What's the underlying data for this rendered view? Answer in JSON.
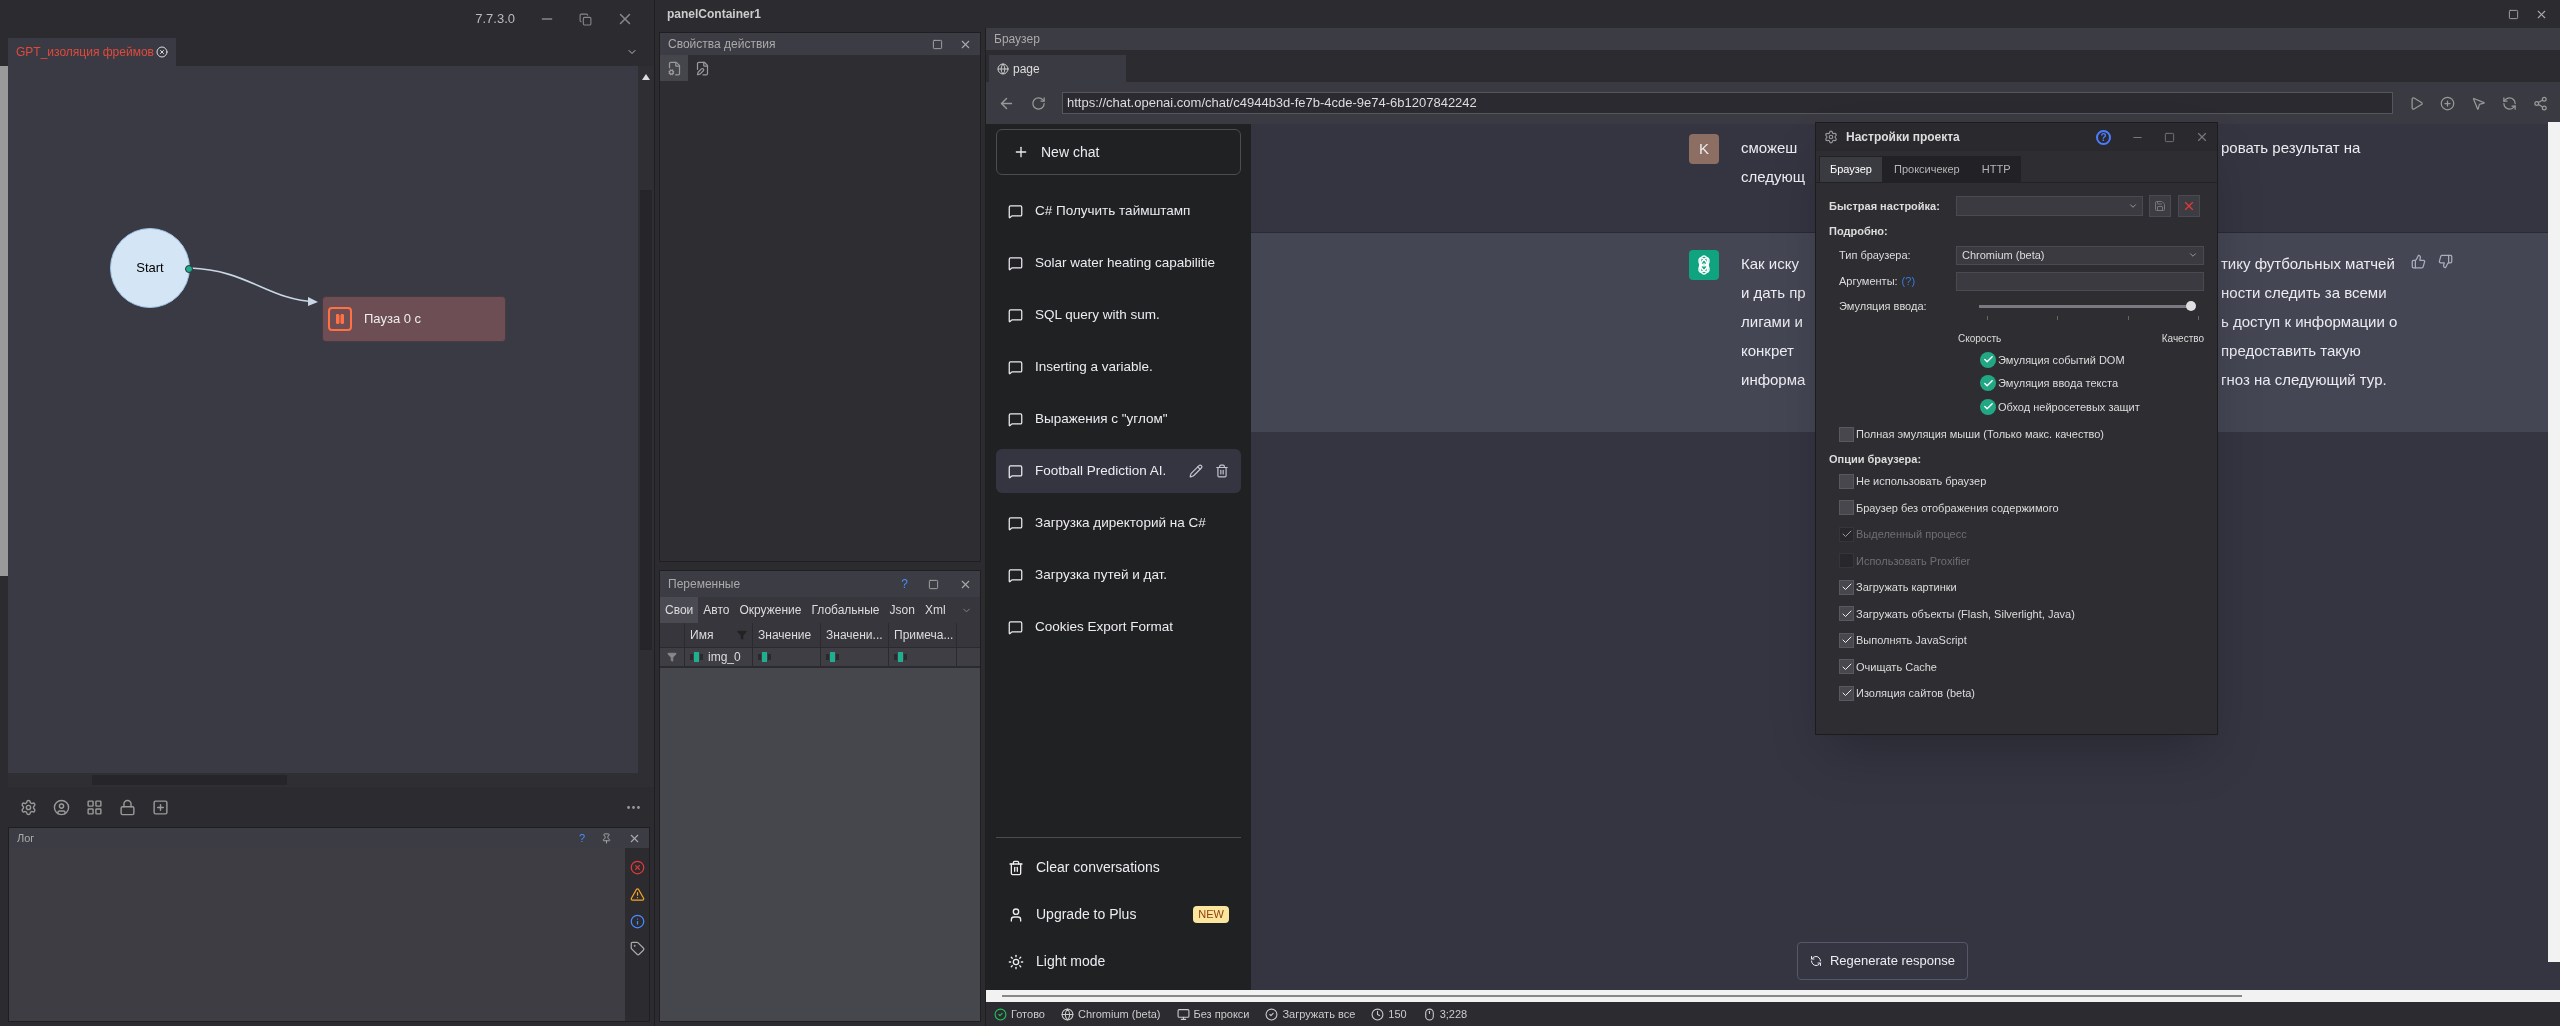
{
  "app": {
    "version": "7.7.3.0"
  },
  "editor": {
    "tab": {
      "label": "GPT_изоляция фреймов"
    },
    "nodes": [
      {
        "kind": "start",
        "label": "Start"
      },
      {
        "kind": "pause",
        "label": "Пауза 0 с"
      }
    ]
  },
  "log_panel": {
    "title": "Лог",
    "help": "?"
  },
  "panel_container": {
    "title": "panelContainer1"
  },
  "action_properties": {
    "title": "Свойства действия",
    "tools": [
      {
        "kind": "settings",
        "selected": true
      },
      {
        "kind": "edit",
        "selected": false
      }
    ]
  },
  "variables": {
    "title": "Переменные",
    "help": "?",
    "tabs": [
      {
        "label": "Свои",
        "selected": true
      },
      {
        "label": "Авто",
        "selected": false
      },
      {
        "label": "Окружение",
        "selected": false
      },
      {
        "label": "Глобальные",
        "selected": false
      },
      {
        "label": "Json",
        "selected": false
      },
      {
        "label": "Xml",
        "selected": false
      }
    ],
    "columns": [
      "Имя",
      "Значение",
      "Значени...",
      "Примеча..."
    ],
    "rows": [
      {
        "name": "img_0"
      }
    ]
  },
  "browser": {
    "title": "Браузер",
    "tab": "page",
    "url": "https://chat.openai.com/chat/c4944b3d-fe7b-4cde-9e74-6b1207842242",
    "sidebar": {
      "new_chat": "New chat",
      "chats": [
        {
          "title": "C# Получить таймштамп",
          "selected": false
        },
        {
          "title": "Solar water heating capabilitie",
          "selected": false
        },
        {
          "title": "SQL query with sum.",
          "selected": false
        },
        {
          "title": "Inserting a variable.",
          "selected": false
        },
        {
          "title": "Выражения с \"углом\"",
          "selected": false
        },
        {
          "title": "Football Prediction AI.",
          "selected": true
        },
        {
          "title": "Загрузка директорий на C#",
          "selected": false
        },
        {
          "title": "Загрузка путей и дат.",
          "selected": false
        },
        {
          "title": "Cookies Export Format",
          "selected": false
        }
      ],
      "footer": [
        {
          "kind": "trash",
          "label": "Clear conversations"
        },
        {
          "kind": "user",
          "label": "Upgrade to Plus",
          "badge": "NEW"
        },
        {
          "kind": "sun",
          "label": "Light mode"
        }
      ]
    },
    "messages": [
      {
        "kind": "user",
        "avatar": "K",
        "lines": [
          {
            "left": "сможеш",
            "right": "ровать результат на"
          },
          {
            "left": "следующ"
          }
        ]
      },
      {
        "kind": "assistant",
        "lines": [
          {
            "left": "Как иску",
            "right": "тику футбольных матчей"
          },
          {
            "left": "и дать пр",
            "right": "ности следить за всеми"
          },
          {
            "left": "лигами и",
            "right": "ь доступ к информации о"
          },
          {
            "left": "конкрет",
            "right": "предоставить такую"
          },
          {
            "left": "информа",
            "right": "гноз на следующий тур."
          }
        ]
      }
    ],
    "regenerate": "Regenerate response"
  },
  "dialog": {
    "title": "Настройки проекта",
    "help": "?",
    "tabs": [
      {
        "label": "Браузер",
        "selected": true
      },
      {
        "label": "Проксичекер",
        "selected": false
      },
      {
        "label": "HTTP",
        "selected": false
      }
    ],
    "quick_setup": {
      "label": "Быстрая настройка:"
    },
    "details_heading": "Подробно:",
    "browser_type": {
      "label": "Тип браузера:",
      "value": "Chromium (beta)"
    },
    "arguments": {
      "label": "Аргументы:",
      "hint": "(?)"
    },
    "input_emulation": {
      "label": "Эмуляция ввода:",
      "level": 1,
      "min_label": "Скорость",
      "max_label": "Качество"
    },
    "emulation_features": [
      {
        "label": "Эмуляция событий DOM",
        "checked": true
      },
      {
        "label": "Эмуляция ввода текста",
        "checked": true
      },
      {
        "label": "Обход нейросетевых защит",
        "checked": true
      }
    ],
    "full_mouse": {
      "label": "Полная эмуляция мыши (Только макс. качество)",
      "checked": false
    },
    "options_heading": "Опции браузера:",
    "options": [
      {
        "label": "Не использовать браузер",
        "checked": false,
        "disabled": false
      },
      {
        "label": "Браузер без отображения содержимого",
        "checked": false,
        "disabled": false
      },
      {
        "label": "Выделенный процесс",
        "checked": true,
        "disabled": true
      },
      {
        "label": "Использовать Proxifier",
        "checked": false,
        "disabled": true
      },
      {
        "label": "Загружать картинки",
        "checked": true,
        "disabled": false
      },
      {
        "label": "Загружать объекты (Flash, Silverlight, Java)",
        "checked": true,
        "disabled": false
      },
      {
        "label": "Выполнять JavaScript",
        "checked": true,
        "disabled": false
      },
      {
        "label": "Очищать Cache",
        "checked": true,
        "disabled": false
      },
      {
        "label": "Изоляция сайтов (beta)",
        "checked": true,
        "disabled": false
      }
    ]
  },
  "status_bar": [
    {
      "kind": "ready",
      "label": "Готово"
    },
    {
      "kind": "browser",
      "label": "Chromium (beta)"
    },
    {
      "kind": "proxy",
      "label": "Без прокси"
    },
    {
      "kind": "load",
      "label": "Загружать все"
    },
    {
      "kind": "threads",
      "label": "150"
    },
    {
      "kind": "mouse",
      "label": "3;228"
    }
  ]
}
